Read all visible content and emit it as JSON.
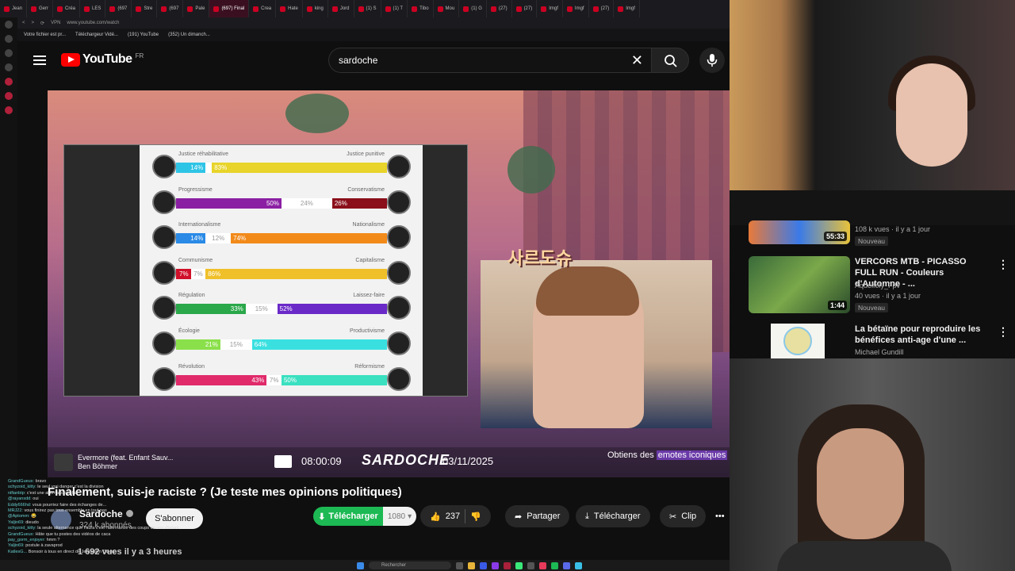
{
  "browser": {
    "tabs": [
      "Jean",
      "Gerr",
      "Créa",
      "LES",
      "(697",
      "Stre",
      "(697",
      "Pale",
      "(697) Final",
      "Crea",
      "Hate",
      "king",
      "Jord",
      "(1) S",
      "(1) T",
      "Tibo",
      "Mou",
      "(1) G",
      "(27)",
      "(27)",
      "Imgf",
      "Imgf",
      "(27)",
      "Imgf"
    ],
    "url": "www.youtube.com/watch",
    "bookmarks": [
      "Votre fichier est pr...",
      "Téléchargeur Vidé...",
      "(191) YouTube",
      "(352) Un dimanch..."
    ]
  },
  "youtube": {
    "logo_text": "YouTube",
    "country": "FR",
    "search_value": "sardoche"
  },
  "video_overlay": {
    "song_line1": "Evermore (feat. Enfant Sauv...",
    "song_line2": "Ben Böhmer",
    "time": "08:00:09",
    "streamer": "SARDOCHE",
    "date": "03/11/2025",
    "emotes_prefix": "Obtiens des ",
    "emotes_highlight": "emotes iconiques",
    "korean_text": "사르도슈"
  },
  "quiz": {
    "axes": [
      {
        "left": "Justice réhabilitative",
        "right": "Justice punitive",
        "left_val": "14%",
        "mid_val": "",
        "right_val": "83%",
        "left_pct": 14,
        "mid_pct": 3,
        "right_pct": 83,
        "left_color": "#2ec4e6",
        "right_color": "#e8d42a"
      },
      {
        "left": "Progressisme",
        "right": "Conservatisme",
        "left_val": "50%",
        "mid_val": "24%",
        "right_val": "26%",
        "left_pct": 50,
        "mid_pct": 24,
        "right_pct": 26,
        "left_color": "#8b1fa3",
        "right_color": "#8a0f1a"
      },
      {
        "left": "Internationalisme",
        "right": "Nationalisme",
        "left_val": "14%",
        "mid_val": "12%",
        "right_val": "74%",
        "left_pct": 14,
        "mid_pct": 12,
        "right_pct": 74,
        "left_color": "#2a8ae6",
        "right_color": "#f28a1a"
      },
      {
        "left": "Communisme",
        "right": "Capitalisme",
        "left_val": "7%",
        "mid_val": "7%",
        "right_val": "86%",
        "left_pct": 7,
        "mid_pct": 7,
        "right_pct": 86,
        "left_color": "#d0102a",
        "right_color": "#f0c02a"
      },
      {
        "left": "Régulation",
        "right": "Laissez-faire",
        "left_val": "33%",
        "mid_val": "15%",
        "right_val": "52%",
        "left_pct": 33,
        "mid_pct": 15,
        "right_pct": 52,
        "left_color": "#2aa84a",
        "right_color": "#6a2ac8"
      },
      {
        "left": "Écologie",
        "right": "Productivisme",
        "left_val": "21%",
        "mid_val": "15%",
        "right_val": "64%",
        "left_pct": 21,
        "mid_pct": 15,
        "right_pct": 64,
        "left_color": "#8ae04a",
        "right_color": "#3ae0e0"
      },
      {
        "left": "Révolution",
        "right": "Réformisme",
        "left_val": "43%",
        "mid_val": "7%",
        "right_val": "50%",
        "left_pct": 43,
        "mid_pct": 7,
        "right_pct": 50,
        "left_color": "#e02a6a",
        "right_color": "#3ae0c0"
      }
    ]
  },
  "video_info": {
    "title": "Finalement, suis-je raciste ? (Je teste mes opinions politiques)",
    "channel": "Sardoche",
    "subscribers": "324 k abonnés",
    "subscribe_label": "S'abonner",
    "download_green": "Télécharger",
    "quality": "1080",
    "likes": "237",
    "share": "Partager",
    "download": "Télécharger",
    "clip": "Clip",
    "views": "1 692 vues  il y a 3 heures"
  },
  "chat": [
    {
      "user": "GrandGueux:",
      "msg": "bravo"
    },
    {
      "user": "schyzoid_kitty:",
      "msg": "le seul vrai danger c'est la division"
    },
    {
      "user": "nifianbtp:",
      "msg": "c'est une alternance enfait"
    },
    {
      "user": "@rayansdd:",
      "msg": "oui"
    },
    {
      "user": "Eddy666hd:",
      "msg": "vous pourriez faire des échanges de..."
    },
    {
      "user": "MRJ22:",
      "msg": "vous finirez pas tous ensemble en tout pas"
    },
    {
      "user": "@Aptomm:",
      "msg": "😂"
    },
    {
      "user": "Yaljin69:",
      "msg": "dieudo"
    },
    {
      "user": "schyzoid_kitty:",
      "msg": "la seule alternance que t'aura c'est l'alternance des coups de rein d'infant"
    },
    {
      "user": "GrandGueux:",
      "msg": "Hâte que tu postes des vidéos de caca"
    },
    {
      "user": "pay_gorm_enjoyer:",
      "msg": "hmm ?"
    },
    {
      "user": "Yaljin69:",
      "msg": "postule à zavaprod"
    },
    {
      "user": "KatlesG...",
      "msg": "Bonsoir à tous en direct de Jerusalem Ouest"
    }
  ],
  "recommended": [
    {
      "title": "",
      "views": "108 k vues · il y a 1 jour",
      "badge": "Nouveau",
      "duration": "55:33",
      "channel": ""
    },
    {
      "title": "VERCORS MTB - PICASSO FULL RUN - Couleurs d'Automne - ...",
      "channel": "Aquelfoly_Fpv",
      "views": "40 vues · il y a 1 jour",
      "badge": "Nouveau",
      "duration": "1:44"
    },
    {
      "title": "La bétaïne pour reproduire les bénéfices anti-age d'une ...",
      "channel": "Michael Gundill",
      "views": "",
      "badge": "",
      "duration": ""
    }
  ],
  "taskbar": {
    "search": "Rechercher"
  },
  "colors": {
    "accent": "#ff0000",
    "download_green": "#1db954"
  }
}
